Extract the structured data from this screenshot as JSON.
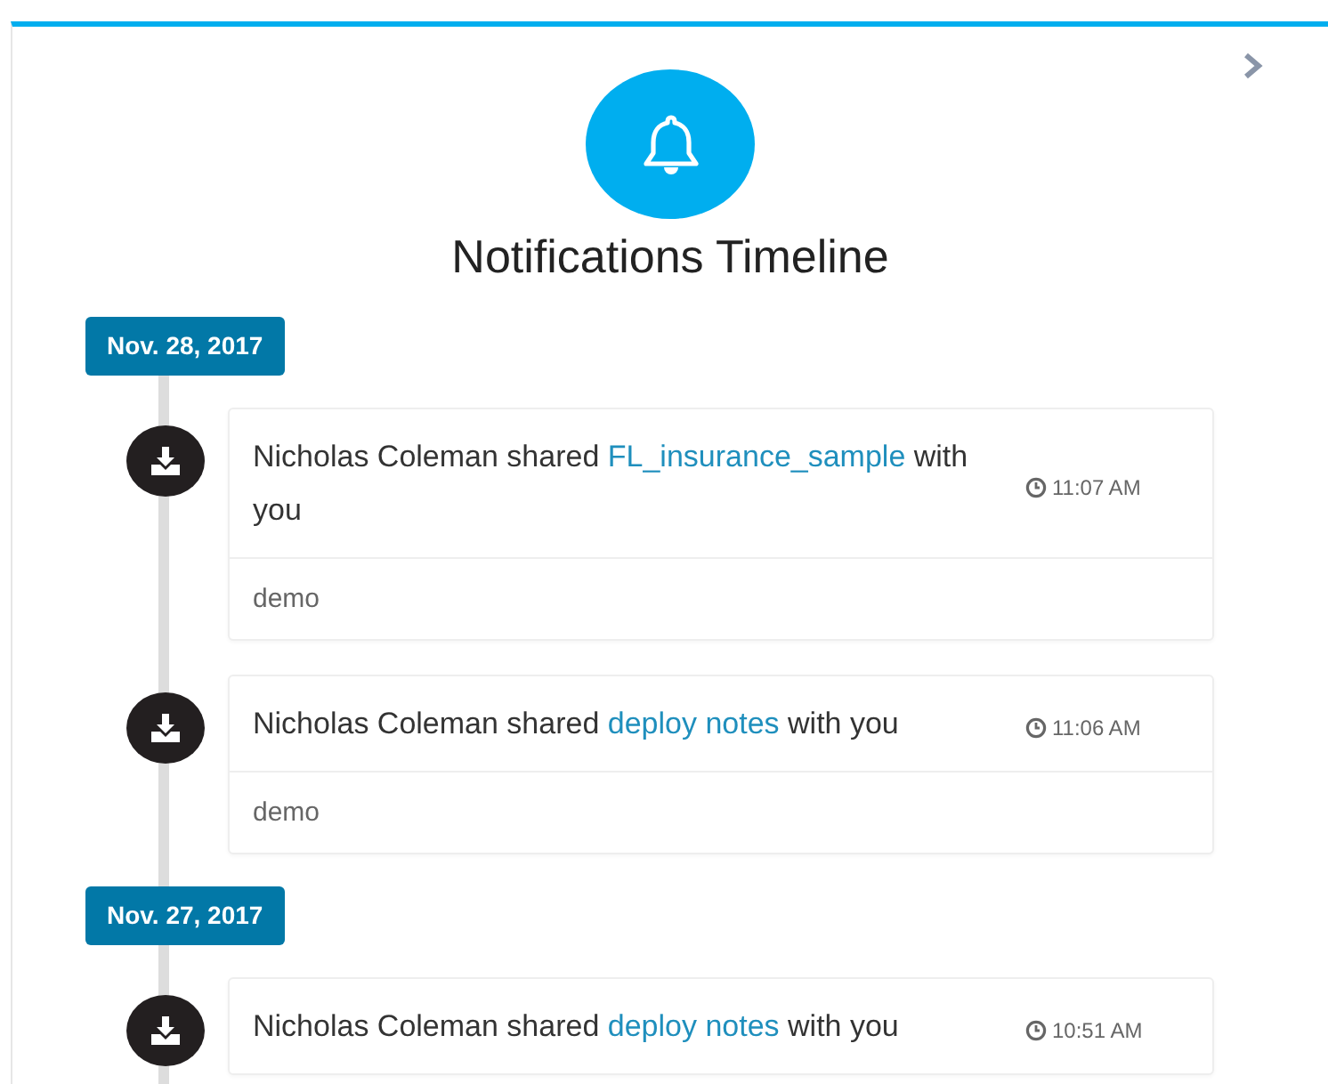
{
  "title": "Notifications Timeline",
  "groups": [
    {
      "date": "Nov. 28, 2017",
      "items": [
        {
          "prefix": "Nicholas Coleman shared",
          "link": "FL_insurance_sample",
          "suffix": "with you",
          "time": "11:07 AM",
          "note": "demo"
        },
        {
          "prefix": "Nicholas Coleman shared",
          "link": "deploy notes",
          "suffix": "with you",
          "time": "11:06 AM",
          "note": "demo"
        }
      ]
    },
    {
      "date": "Nov. 27, 2017",
      "items": [
        {
          "prefix": "Nicholas Coleman shared",
          "link": "deploy notes",
          "suffix": "with you",
          "time": "10:51 AM"
        }
      ]
    }
  ]
}
